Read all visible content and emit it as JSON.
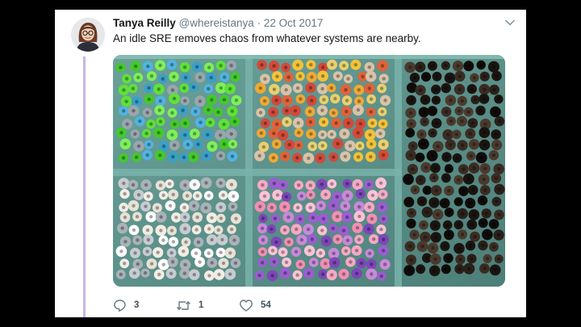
{
  "tweet": {
    "author_name": "Tanya Reilly",
    "handle": "@whereistanya",
    "separator": "·",
    "date": "22 Oct 2017",
    "text": "An idle SRE removes chaos from whatever systems are nearby.",
    "reply_count": "3",
    "retweet_count": "1",
    "like_count": "54"
  },
  "icons": {
    "reply": "speech-bubble-icon",
    "retweet": "retweet-arrows-icon",
    "like": "heart-outline-icon",
    "menu": "chevron-down-icon"
  },
  "colors": {
    "text": "#14171a",
    "muted": "#657786",
    "thread_line": "#c9b6e4",
    "tray": "#5e8f88"
  }
}
